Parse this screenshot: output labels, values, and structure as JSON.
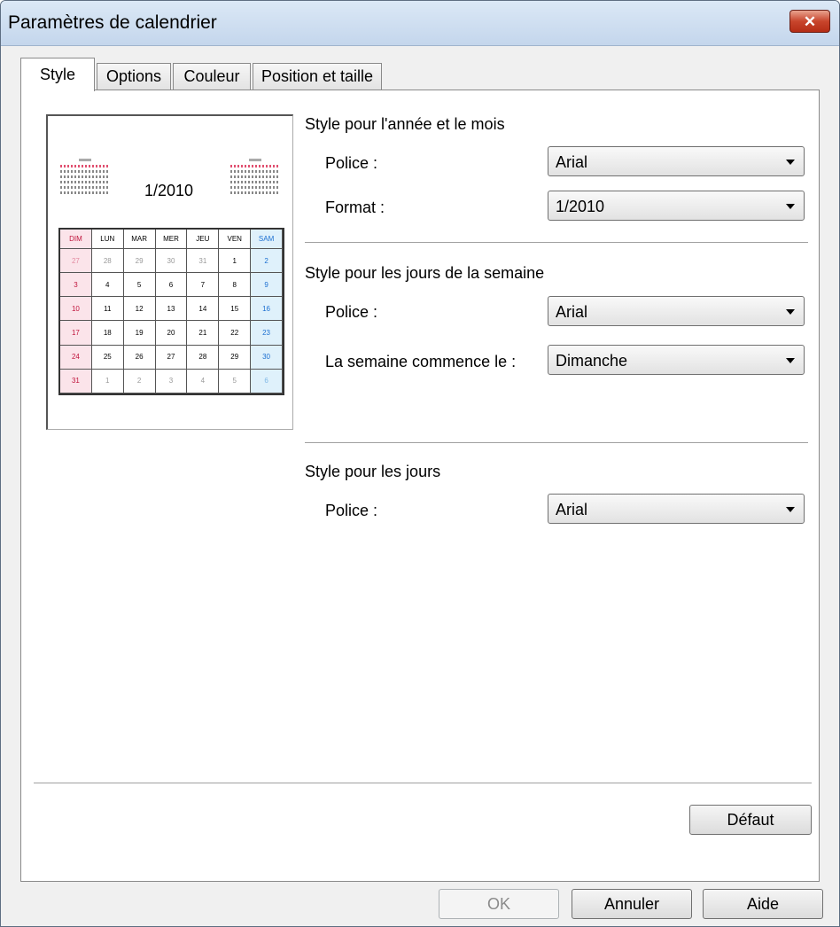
{
  "window": {
    "title": "Paramètres de calendrier"
  },
  "tabs": [
    {
      "label": "Style",
      "active": true
    },
    {
      "label": "Options",
      "active": false
    },
    {
      "label": "Couleur",
      "active": false
    },
    {
      "label": "Position et taille",
      "active": false
    }
  ],
  "preview": {
    "title": "1/2010",
    "headers": [
      "DIM",
      "LUN",
      "MAR",
      "MER",
      "JEU",
      "VEN",
      "SAM"
    ],
    "rows": [
      [
        "27",
        "28",
        "29",
        "30",
        "31",
        "1",
        "2"
      ],
      [
        "3",
        "4",
        "5",
        "6",
        "7",
        "8",
        "9"
      ],
      [
        "10",
        "11",
        "12",
        "13",
        "14",
        "15",
        "16"
      ],
      [
        "17",
        "18",
        "19",
        "20",
        "21",
        "22",
        "23"
      ],
      [
        "24",
        "25",
        "26",
        "27",
        "28",
        "29",
        "30"
      ],
      [
        "31",
        "1",
        "2",
        "3",
        "4",
        "5",
        "6"
      ]
    ]
  },
  "year_month": {
    "title": "Style pour l'année et le mois",
    "font_label": "Police :",
    "font_value": "Arial",
    "format_label": "Format :",
    "format_value": "1/2010"
  },
  "weekdays": {
    "title": "Style pour les jours de la semaine",
    "font_label": "Police :",
    "font_value": "Arial",
    "start_label": "La semaine commence le :",
    "start_value": "Dimanche"
  },
  "days": {
    "title": "Style pour les jours",
    "font_label": "Police :",
    "font_value": "Arial"
  },
  "buttons": {
    "default": "Défaut",
    "ok": "OK",
    "cancel": "Annuler",
    "help": "Aide"
  }
}
